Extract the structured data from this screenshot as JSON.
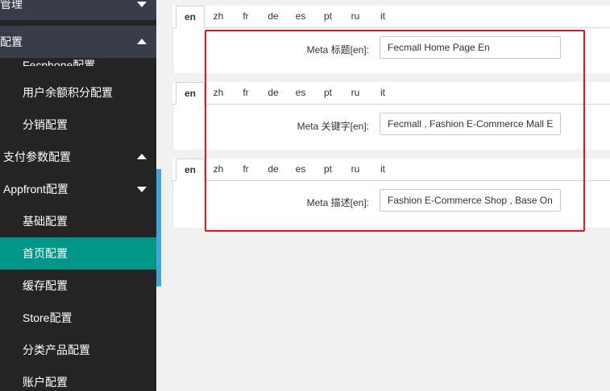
{
  "sidebar": {
    "items": [
      {
        "label": "城管理",
        "caret": "down"
      },
      {
        "label": "站配置",
        "caret": "up"
      },
      {
        "label": "Fecphone配置"
      },
      {
        "label": "用户余额积分配置"
      },
      {
        "label": "分销配置"
      },
      {
        "label": "支付参数配置",
        "caret": "up"
      },
      {
        "label": "Appfront配置",
        "caret": "down"
      },
      {
        "label": "基础配置"
      },
      {
        "label": "首页配置"
      },
      {
        "label": "缓存配置"
      },
      {
        "label": "Store配置"
      },
      {
        "label": "分类产品配置"
      },
      {
        "label": "账户配置"
      }
    ]
  },
  "tabs": [
    "en",
    "zh",
    "fr",
    "de",
    "es",
    "pt",
    "ru",
    "it"
  ],
  "fields": [
    {
      "label": "Meta 标题[en]:",
      "value": "Fecmall Home Page En"
    },
    {
      "label": "Meta 关键字[en]:",
      "value": "Fecmall , Fashion E-Commerce Mall E"
    },
    {
      "label": "Meta 描述[en]:",
      "value": "Fashion E-Commerce Shop , Base On"
    }
  ],
  "colors": {
    "sidebar_bg": "#242424",
    "active_item": "#009688",
    "highlight": "#e0161b"
  }
}
